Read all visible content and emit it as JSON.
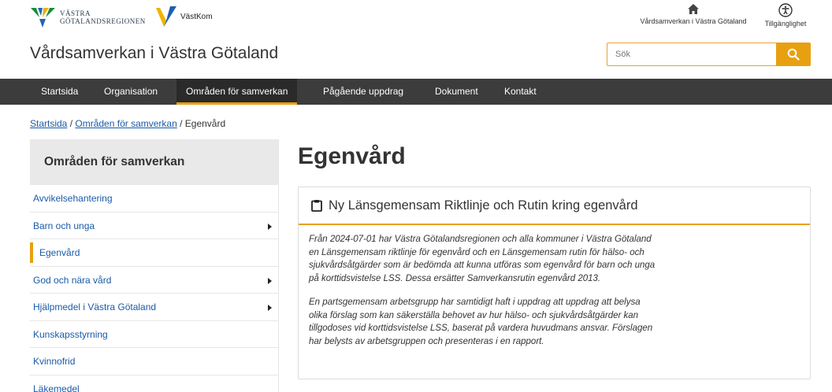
{
  "header": {
    "logo_vgr_line1": "VÄSTRA",
    "logo_vgr_line2": "GÖTALANDSREGIONEN",
    "logo_vk": "VästKom",
    "site_title": "Vårdsamverkan i Västra Götaland",
    "home_link": "Vårdsamverkan i Västra Götaland",
    "accessibility_link": "Tillgänglighet",
    "search_placeholder": "Sök"
  },
  "nav": {
    "items": [
      "Startsida",
      "Organisation",
      "Områden för samverkan",
      "Pågående uppdrag",
      "Dokument",
      "Kontakt"
    ]
  },
  "breadcrumb": {
    "home": "Startsida",
    "sep1": " / ",
    "parent": "Områden för samverkan",
    "sep2": " / ",
    "current": "Egenvård"
  },
  "sidebar": {
    "heading": "Områden för samverkan",
    "items": [
      {
        "label": "Avvikelsehantering"
      },
      {
        "label": "Barn och unga"
      },
      {
        "label": "Egenvård"
      },
      {
        "label": "God och nära vård"
      },
      {
        "label": "Hjälpmedel i Västra Götaland"
      },
      {
        "label": "Kunskapsstyrning"
      },
      {
        "label": "Kvinnofrid"
      },
      {
        "label": "Läkemedel"
      }
    ]
  },
  "main": {
    "title": "Egenvård",
    "card_title": "Ny Länsgemensam Riktlinje och Rutin kring egenvård",
    "paragraph1": "Från 2024-07-01 har Västra Götalandsregionen och alla kommuner i Västra Götaland\n en Länsgemensam riktlinje för egenvård och en Länsgemensam rutin för hälso- och\nsjukvårdsåtgärder som är bedömda att kunna utföras som egenvård för barn och unga\npå korttidsvistelse LSS. Dessa ersätter Samverkansrutin egenvård 2013.",
    "paragraph2": "En partsgemensam arbetsgrupp har samtidigt haft i uppdrag att uppdrag att belysa\nolika förslag som kan säkerställa behovet av hur hälso- och sjukvårdsåtgärder kan\ntillgodoses vid korttidsvistelse LSS, baserat på vardera huvudmans ansvar. Förslagen\nhar belysts av arbetsgruppen och presenteras i en rapport."
  },
  "colors": {
    "accent": "#e8a010",
    "nav_bg": "#3c3c3c",
    "link": "#1a5aa8"
  },
  "icons": [
    "vgr-logo-icon",
    "vastkom-logo-icon",
    "home-icon",
    "accessibility-icon",
    "search-icon",
    "clipboard-icon",
    "chevron-right-icon"
  ]
}
